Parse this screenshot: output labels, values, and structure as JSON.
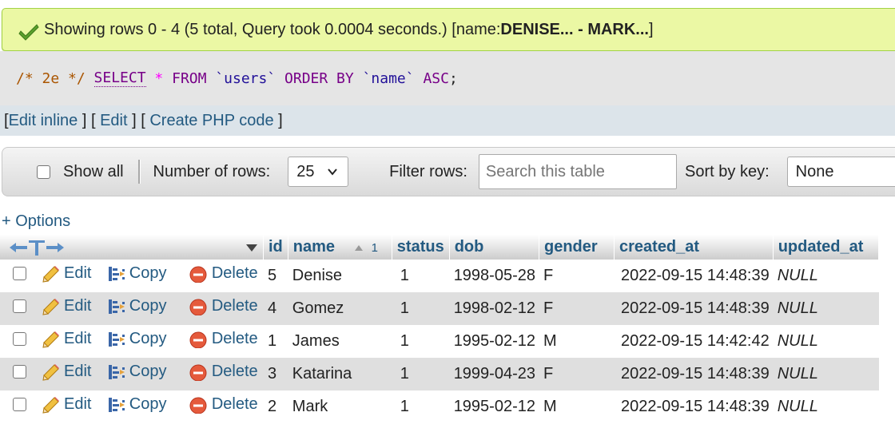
{
  "message": {
    "prefix": "Showing rows 0 - 4 (5 total, Query took 0.0004 seconds.) [name: ",
    "range": "DENISE... - MARK...",
    "suffix": "]"
  },
  "sql": {
    "comment": "/* 2e */",
    "select": "SELECT",
    "star": "*",
    "from": "FROM",
    "table": "`users`",
    "order": "ORDER BY",
    "column": "`name`",
    "dir": "ASC",
    "end": ";"
  },
  "sql_links": {
    "open1": "[ ",
    "edit_inline": "Edit inline",
    "mid1": " ] [ ",
    "edit": "Edit",
    "mid2": " ] [ ",
    "create_php": "Create PHP code",
    "close": " ]"
  },
  "navbar": {
    "show_all": "Show all",
    "num_rows_label": "Number of rows:",
    "num_rows_value": "25",
    "filter_label": "Filter rows:",
    "filter_placeholder": "Search this table",
    "sort_label": "Sort by key:",
    "sort_value": "None"
  },
  "options_link": "+ Options",
  "table": {
    "columns": [
      "id",
      "name",
      "status",
      "dob",
      "gender",
      "created_at",
      "updated_at"
    ],
    "sort_index": "1",
    "action_edit": "Edit",
    "action_copy": "Copy",
    "action_delete": "Delete",
    "rows": [
      {
        "id": "5",
        "name": "Denise",
        "status": "1",
        "dob": "1998-05-28",
        "gender": "F",
        "created_at": "2022-09-15 14:48:39",
        "updated_at": "NULL"
      },
      {
        "id": "4",
        "name": "Gomez",
        "status": "1",
        "dob": "1998-02-12",
        "gender": "F",
        "created_at": "2022-09-15 14:48:39",
        "updated_at": "NULL"
      },
      {
        "id": "1",
        "name": "James",
        "status": "1",
        "dob": "1995-02-12",
        "gender": "M",
        "created_at": "2022-09-15 14:42:42",
        "updated_at": "NULL"
      },
      {
        "id": "3",
        "name": "Katarina",
        "status": "1",
        "dob": "1999-04-23",
        "gender": "F",
        "created_at": "2022-09-15 14:48:39",
        "updated_at": "NULL"
      },
      {
        "id": "2",
        "name": "Mark",
        "status": "1",
        "dob": "1995-02-12",
        "gender": "M",
        "created_at": "2022-09-15 14:48:39",
        "updated_at": "NULL"
      }
    ]
  },
  "icons": {
    "success": "check-icon",
    "edit": "pencil-icon",
    "copy": "copy-icon",
    "delete": "delete-icon"
  },
  "colors": {
    "link": "#235a81",
    "success_bg": "#ebf8a4",
    "delete_red": "#e55a3c"
  }
}
